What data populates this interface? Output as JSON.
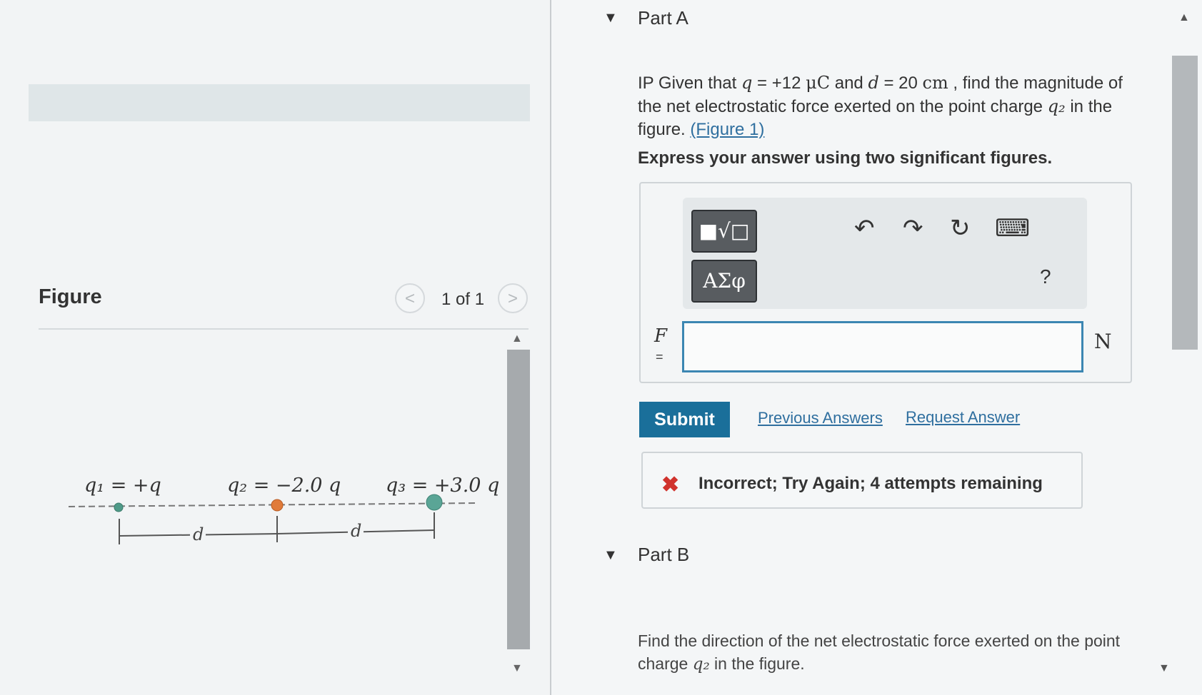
{
  "figure_panel": {
    "title": "Figure",
    "pager_prev": "<",
    "pager_count": "1 of 1",
    "pager_next": ">",
    "charges": {
      "q1": "q₁ = +q",
      "q2": "q₂ = −2.0 q",
      "q3": "q₃ = +3.0 q"
    },
    "distance_label": "d",
    "colors": {
      "q1": "#4f9a88",
      "q2": "#e07b3a",
      "q3": "#5aa596"
    }
  },
  "part_a": {
    "title": "Part A",
    "question": {
      "t1": "IP Given that ",
      "q_var": "q",
      "t2": " = +12 ",
      "q_unit": "μC",
      "t3": " and ",
      "d_var": "d",
      "t4": " = 20 ",
      "d_unit": "cm",
      "t5": " , find the magnitude of the net electrostatic force exerted on the point charge ",
      "q2_var": "q₂",
      "t6": " in the figure. ",
      "figure_link": "(Figure 1)"
    },
    "instruction": "Express your answer using two significant figures.",
    "toolbar": {
      "template_btn": "■√□",
      "greek_btn": "ΑΣφ",
      "undo_icon": "↶",
      "redo_icon": "↷",
      "reset_icon": "↻",
      "keyboard_icon": "⌨",
      "help": "?"
    },
    "variable": "F",
    "equals": "=",
    "answer_value": "",
    "unit": "N",
    "submit": "Submit",
    "previous_answers": "Previous Answers",
    "request_answer": "Request Answer",
    "feedback_icon": "✖",
    "feedback": "Incorrect; Try Again; 4 attempts remaining"
  },
  "part_b": {
    "title": "Part B",
    "t1": "Find the direction of the net electrostatic force exerted on the point charge ",
    "q2_var": "q₂",
    "t2": " in the figure."
  },
  "caret_icon": "▼",
  "scroll_up_icon": "▲",
  "scroll_down_icon": "▼"
}
